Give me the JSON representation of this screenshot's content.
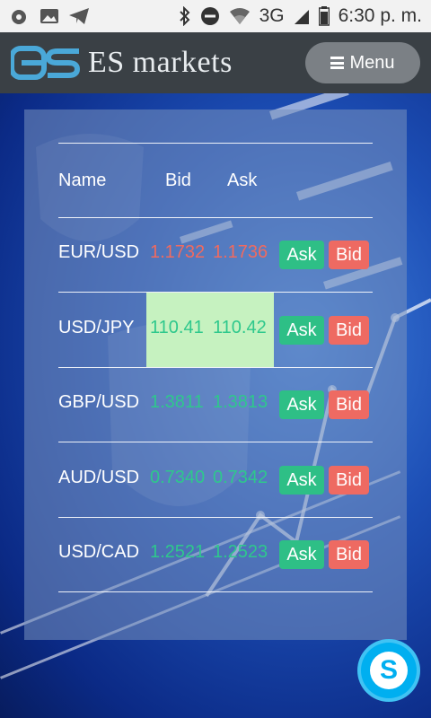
{
  "status_bar": {
    "network": "3G",
    "time": "6:30 p. m."
  },
  "header": {
    "brand": "ES markets",
    "logo_text": "ES",
    "menu_label": "Menu"
  },
  "table": {
    "columns": {
      "name": "Name",
      "bid": "Bid",
      "ask": "Ask"
    },
    "rows": [
      {
        "name": "EUR/USD",
        "bid": "1.1732",
        "ask": "1.1736",
        "color": "red",
        "ask_button": "Ask",
        "bid_button": "Bid"
      },
      {
        "name": "USD/JPY",
        "bid": "110.41",
        "ask": "110.42",
        "color": "green",
        "highlight": true,
        "ask_button": "Ask",
        "bid_button": "Bid"
      },
      {
        "name": "GBP/USD",
        "bid": "1.3811",
        "ask": "1.3813",
        "color": "green",
        "ask_button": "Ask",
        "bid_button": "Bid"
      },
      {
        "name": "AUD/USD",
        "bid": "0.7340",
        "ask": "0.7342",
        "color": "green",
        "ask_button": "Ask",
        "bid_button": "Bid"
      },
      {
        "name": "USD/CAD",
        "bid": "1.2521",
        "ask": "1.2523",
        "color": "green",
        "ask_button": "Ask",
        "bid_button": "Bid"
      }
    ]
  },
  "colors": {
    "header_bg": "#3a4045",
    "ask_button": "#2ebf86",
    "bid_button": "#ee6a62",
    "price_up": "#2ec88c",
    "price_down": "#f06a5f",
    "highlight": "#c6f2c0",
    "skype": "#00aff0"
  },
  "skype": {
    "icon": "skype-icon",
    "letter": "S"
  }
}
